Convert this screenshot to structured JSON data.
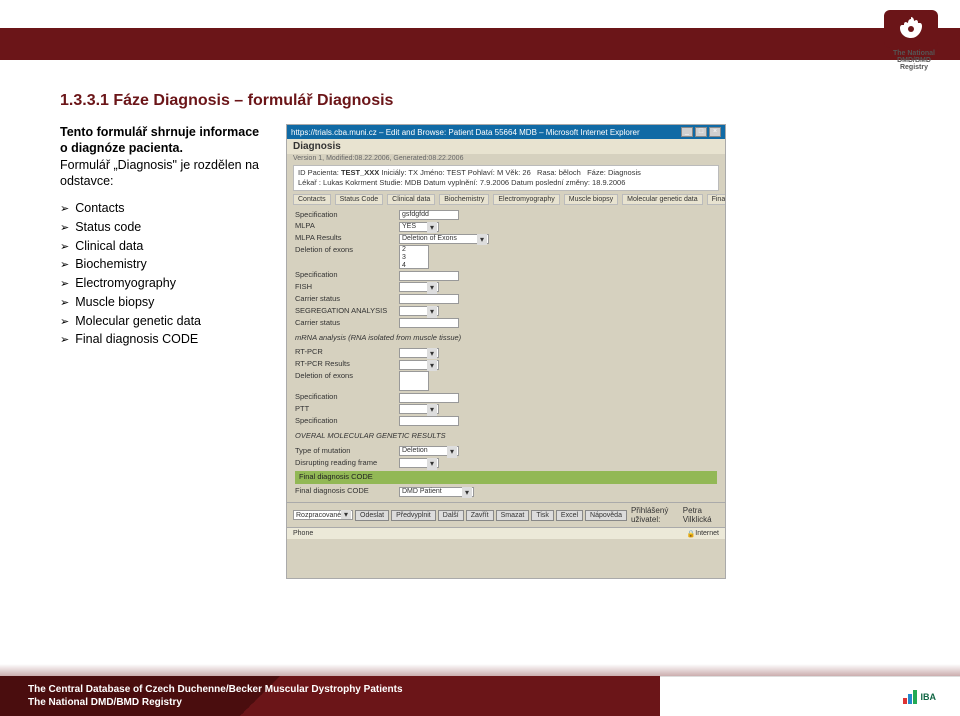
{
  "header": {
    "registry_text": "The National DMD/BMD Registry"
  },
  "section": {
    "title": "1.3.3.1  Fáze Diagnosis – formulář Diagnosis",
    "intro1": "Tento formulář shrnuje informace o diagnóze pacienta.",
    "intro2": "Formulář „Diagnosis\" je rozdělen na odstavce:",
    "bullets": [
      "Contacts",
      "Status code",
      "Clinical data",
      "Biochemistry",
      "Electromyography",
      "Muscle biopsy",
      "Molecular genetic data",
      "Final diagnosis CODE"
    ]
  },
  "screenshot": {
    "titlebar": "https://trials.cba.muni.cz – Edit and Browse: Patient Data 55664 MDB – Microsoft Internet Explorer",
    "heading": "Diagnosis",
    "version": "Version 1, Modified:08.22.2006, Generated:08.22.2006",
    "pt_line1": {
      "id_label": "ID Pacienta:",
      "id": "TEST_XXX",
      "init_label": "Iniciály:",
      "init": "TX",
      "name_label": "Jméno:",
      "name": "TEST",
      "sex_label": "Pohlaví:",
      "sex": "M",
      "age_label": "Věk:",
      "age": "26",
      "race_label": "Rasa:",
      "race": "běloch",
      "phase_label": "Fáze:",
      "phase": "Diagnosis"
    },
    "pt_line2": {
      "doc_label": "Lékař :",
      "doc": "Lukas Kokrment",
      "study_label": "Studie:",
      "study": "MDB",
      "fill_label": "Datum vyplnění:",
      "fill": "7.9.2006",
      "chg_label": "Datum poslední změny:",
      "chg": "18.9.2006"
    },
    "tabs": [
      "Contacts",
      "Status Code",
      "Clinical data",
      "Biochemistry",
      "Electromyography",
      "Muscle biopsy",
      "Molecular genetic data",
      "Final diagnosis CODE"
    ],
    "form": {
      "specification": "Specification",
      "spec_val": "gsfdgfdd",
      "mlpa": "MLPA",
      "mlpa_val": "YES",
      "mlpa_res": "MLPA Results",
      "mlpa_res_val": "Deletion of Exons",
      "del_exons": "Deletion of exons",
      "del_exons_vals": "2\n3\n4",
      "fish": "FISH",
      "carrier": "Carrier status",
      "seg": "SEGREGATION ANALYSIS",
      "mrna": "mRNA analysis (RNA isolated from muscle tissue)",
      "rtpcr": "RT-PCR",
      "rtpcr_res": "RT-PCR Results",
      "ptt": "PTT",
      "overall": "OVERAL MOLECULAR GENETIC RESULTS",
      "type_mut": "Type of mutation",
      "type_mut_val": "Deletion",
      "disrupt": "Disrupting reading frame",
      "final_bar": "Final diagnosis CODE",
      "final_code": "Final diagnosis CODE",
      "final_code_val": "DMD Patient"
    },
    "bottom": {
      "state": "Rozpracované",
      "b1": "Odeslat",
      "b2": "Předvyplnit",
      "b3": "Další",
      "b4": "Zavřít",
      "b5": "Smazat",
      "b6": "Tisk",
      "b7": "Excel",
      "b8": "Nápověda",
      "user_label": "Přihlášený uživatel:",
      "user": "Petra Vilklická"
    },
    "status": {
      "left": "Phone",
      "right": "Internet"
    }
  },
  "footer": {
    "line1": "The Central Database of Czech Duchenne/Becker Muscular Dystrophy Patients",
    "line2": "The National DMD/BMD Registry",
    "iba": "IBA"
  }
}
